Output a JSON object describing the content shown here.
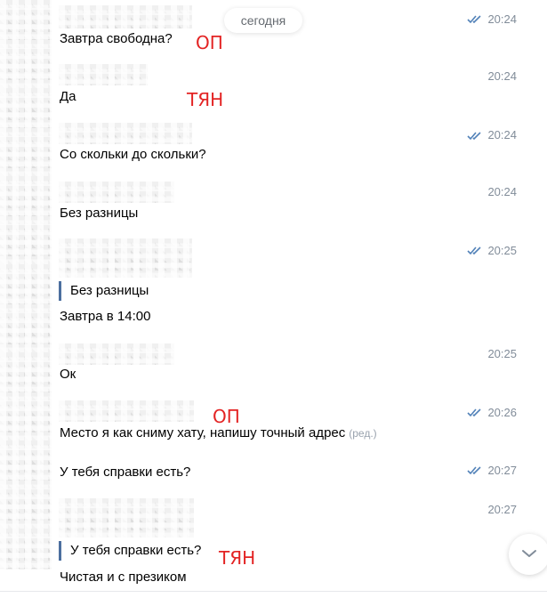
{
  "date_separator": "сегодня",
  "messages": [
    {
      "text": "Завтра свободна?",
      "time": "20:24",
      "read": true
    },
    {
      "text": "Да",
      "time": "20:24",
      "read": false
    },
    {
      "text": "Со скольки до скольки?",
      "time": "20:24",
      "read": true
    },
    {
      "text": "Без разницы",
      "time": "20:24",
      "read": false
    },
    {
      "reply_quote": "Без разницы",
      "text": "Завтра в 14:00",
      "time": "20:25",
      "read": true
    },
    {
      "text": "Ок",
      "time": "20:25",
      "read": false
    },
    {
      "text": "Место я как сниму хату, напишу точный адрес",
      "edited": "(ред.)",
      "time": "20:26",
      "read": true
    },
    {
      "text": "У тебя справки есть?",
      "time": "20:27",
      "read": true
    },
    {
      "reply_quote": "У тебя справки есть?",
      "text": "Чистая и с презиком",
      "time": "20:27",
      "read": false
    }
  ],
  "annotations": [
    "ОП",
    "ТЯН",
    "ОП",
    "ТЯН"
  ],
  "icons": {
    "read_status": "double-check-icon",
    "scroll_down": "chevron-down-icon"
  },
  "colors": {
    "annotation": "#e32323",
    "time": "#818c99",
    "ticks": "#5181b8",
    "reply_bar": "#4c6f9f"
  }
}
